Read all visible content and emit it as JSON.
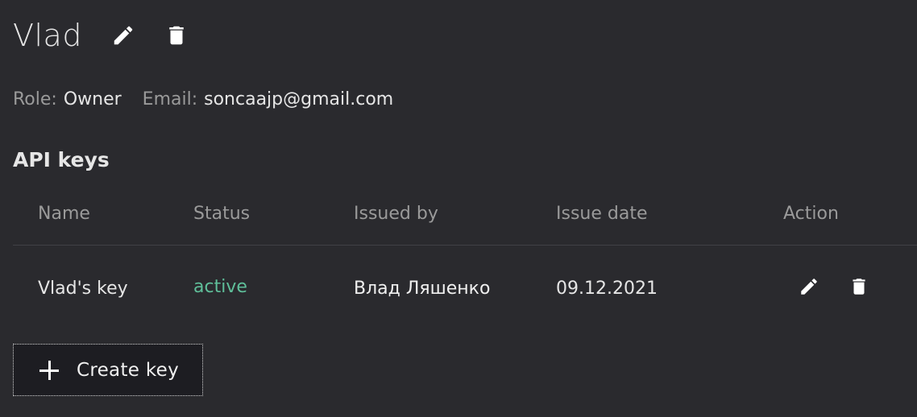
{
  "user": {
    "name": "Vlad",
    "role_label": "Role:",
    "role": "Owner",
    "email_label": "Email:",
    "email": "soncaajp@gmail.com"
  },
  "api_keys": {
    "title": "API keys",
    "columns": [
      "Name",
      "Status",
      "Issued by",
      "Issue date",
      "Action"
    ],
    "rows": [
      {
        "name": "Vlad's key",
        "status": "active",
        "issued_by": "Влад Ляшенко",
        "issue_date": "09.12.2021"
      }
    ],
    "create_label": "Create key"
  },
  "colors": {
    "background": "#2a2a2e",
    "status_active": "#5fbf9a",
    "muted_text": "#9a9a9a",
    "button_background": "#1d1d22"
  },
  "icons": {
    "edit": "pencil-icon",
    "delete": "trash-icon",
    "add": "plus-icon"
  }
}
